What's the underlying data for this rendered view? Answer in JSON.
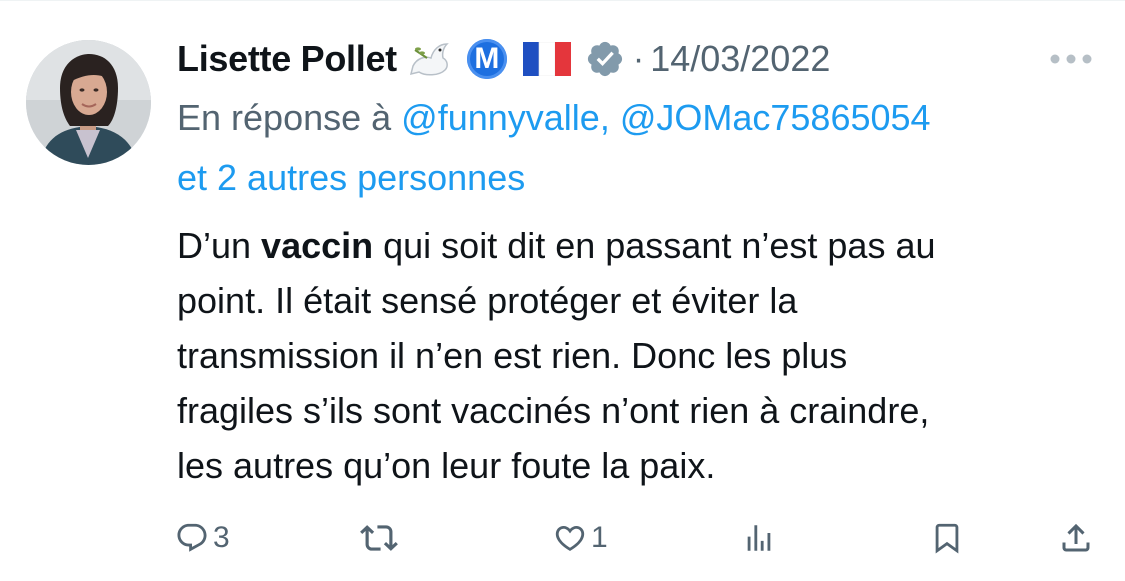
{
  "tweet": {
    "author_name": "Lisette Pollet",
    "badge_letter": "M",
    "separator": "·",
    "date": "14/03/2022",
    "reply_prefix": "En réponse à",
    "reply_handles": "@funnyvalle, @JOMac75865054",
    "reply_others": "et 2 autres personnes",
    "body": {
      "line1_a": "D’un ",
      "line1_bold": "vaccin",
      "line1_b": " qui soit dit en passant n’est pas au",
      "line2": "point.  Il était sensé protéger et éviter la",
      "line3": "transmission il n’en est rien. Donc les plus",
      "line4": "fragiles s’ils sont vaccinés n’ont rien à craindre,",
      "line5": "les autres qu’on leur foute la paix."
    },
    "actions": {
      "replies": "3",
      "likes": "1"
    }
  },
  "icons": {
    "header": [
      "dove-icon",
      "m-badge-icon",
      "france-flag-icon",
      "verified-badge-icon",
      "more-icon"
    ],
    "actions": [
      "reply-icon",
      "retweet-icon",
      "like-icon",
      "views-icon",
      "bookmark-icon",
      "share-icon"
    ]
  },
  "colors": {
    "text": "#0f1419",
    "secondary": "#536471",
    "link": "#1d9bf0",
    "badge_blue": "#1d6fe0",
    "flag_blue": "#1f4fc1",
    "flag_red": "#e4363c"
  }
}
